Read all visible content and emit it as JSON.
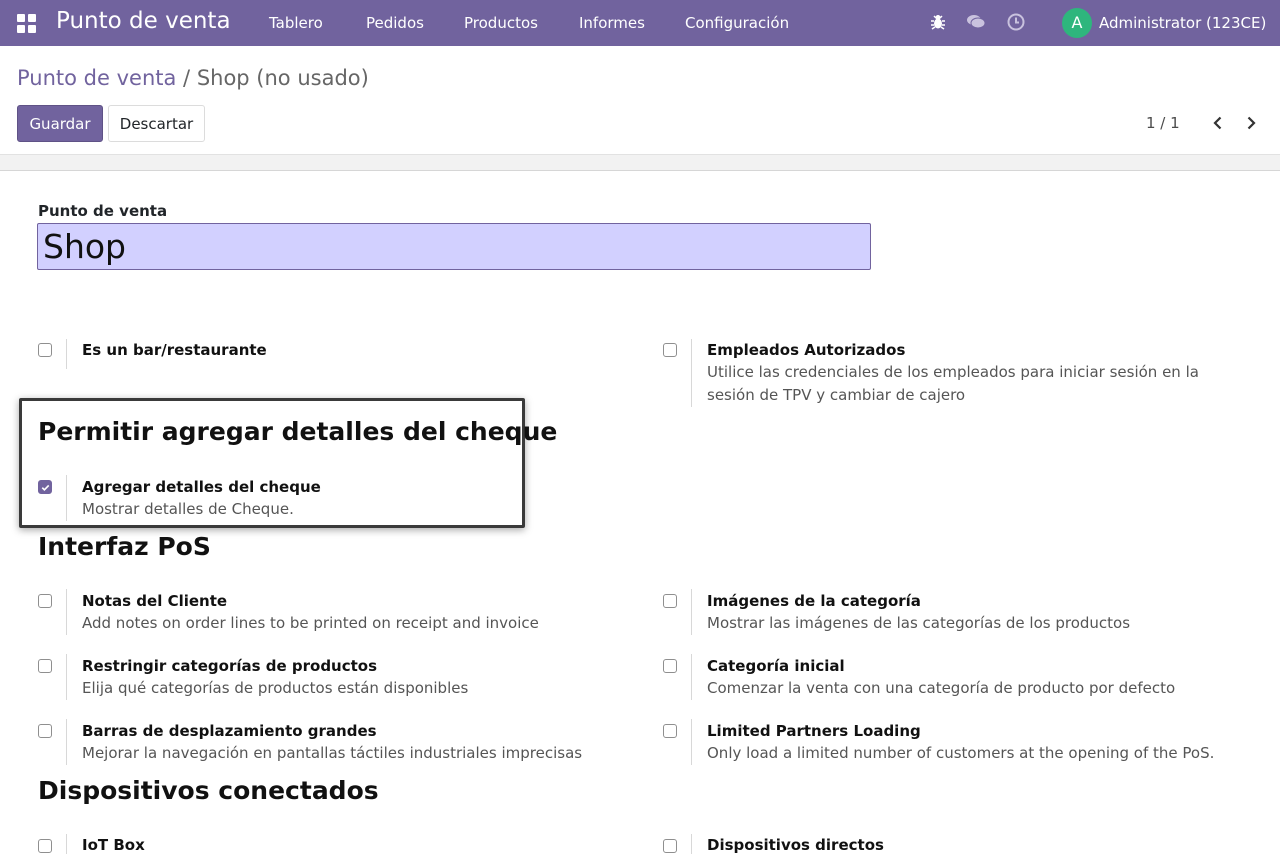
{
  "navbar": {
    "brand": "Punto de venta",
    "menu": [
      "Tablero",
      "Pedidos",
      "Productos",
      "Informes",
      "Configuración"
    ],
    "icons": [
      "apps-grid-icon",
      "bug-icon",
      "chat-icon",
      "clock-icon"
    ],
    "user_initial": "A",
    "user_name": "Administrator (123CE)",
    "colors": {
      "bar": "#71639e",
      "avatar": "#2eb67d"
    }
  },
  "breadcrumb": {
    "parent": "Punto de venta",
    "separator": "/",
    "current": "Shop (no usado)"
  },
  "actions": {
    "save_label": "Guardar",
    "discard_label": "Descartar"
  },
  "pager": {
    "text": "1 / 1"
  },
  "form": {
    "name_label": "Punto de venta",
    "name_value": "Shop",
    "options_top": [
      {
        "title": "Es un bar/restaurante",
        "desc": "",
        "checked": false
      },
      {
        "title": "Empleados Autorizados",
        "desc": "Utilice las credenciales de los empleados para iniciar sesión en la",
        "desc2": "sesión de TPV y cambiar de cajero",
        "checked": false
      }
    ],
    "check_section": {
      "title": "Permitir agregar detalles del cheque",
      "option_title": "Agregar detalles del cheque",
      "option_desc": "Mostrar detalles de Cheque.",
      "checked": true
    },
    "pos_section": {
      "title": "Interfaz PoS",
      "options": [
        {
          "title": "Notas del Cliente",
          "desc": "Add notes on order lines to be printed on receipt and invoice",
          "checked": false
        },
        {
          "title": "Imágenes de la categoría",
          "desc": "Mostrar las imágenes de las categorías de los productos",
          "checked": false
        },
        {
          "title": "Restringir categorías de productos",
          "desc": "Elija qué categorías de productos están disponibles",
          "checked": false
        },
        {
          "title": "Categoría inicial",
          "desc": "Comenzar la venta con una categoría de producto por defecto",
          "checked": false
        },
        {
          "title": "Barras de desplazamiento grandes",
          "desc": "Mejorar la navegación en pantallas táctiles industriales imprecisas",
          "checked": false
        },
        {
          "title": "Limited Partners Loading",
          "desc": "Only load a limited number of customers at the opening of the PoS.",
          "checked": false
        }
      ]
    },
    "devices_section": {
      "title": "Dispositivos conectados",
      "options": [
        {
          "title": "IoT Box",
          "checked": false
        },
        {
          "title": "Dispositivos directos",
          "checked": false
        }
      ]
    }
  }
}
